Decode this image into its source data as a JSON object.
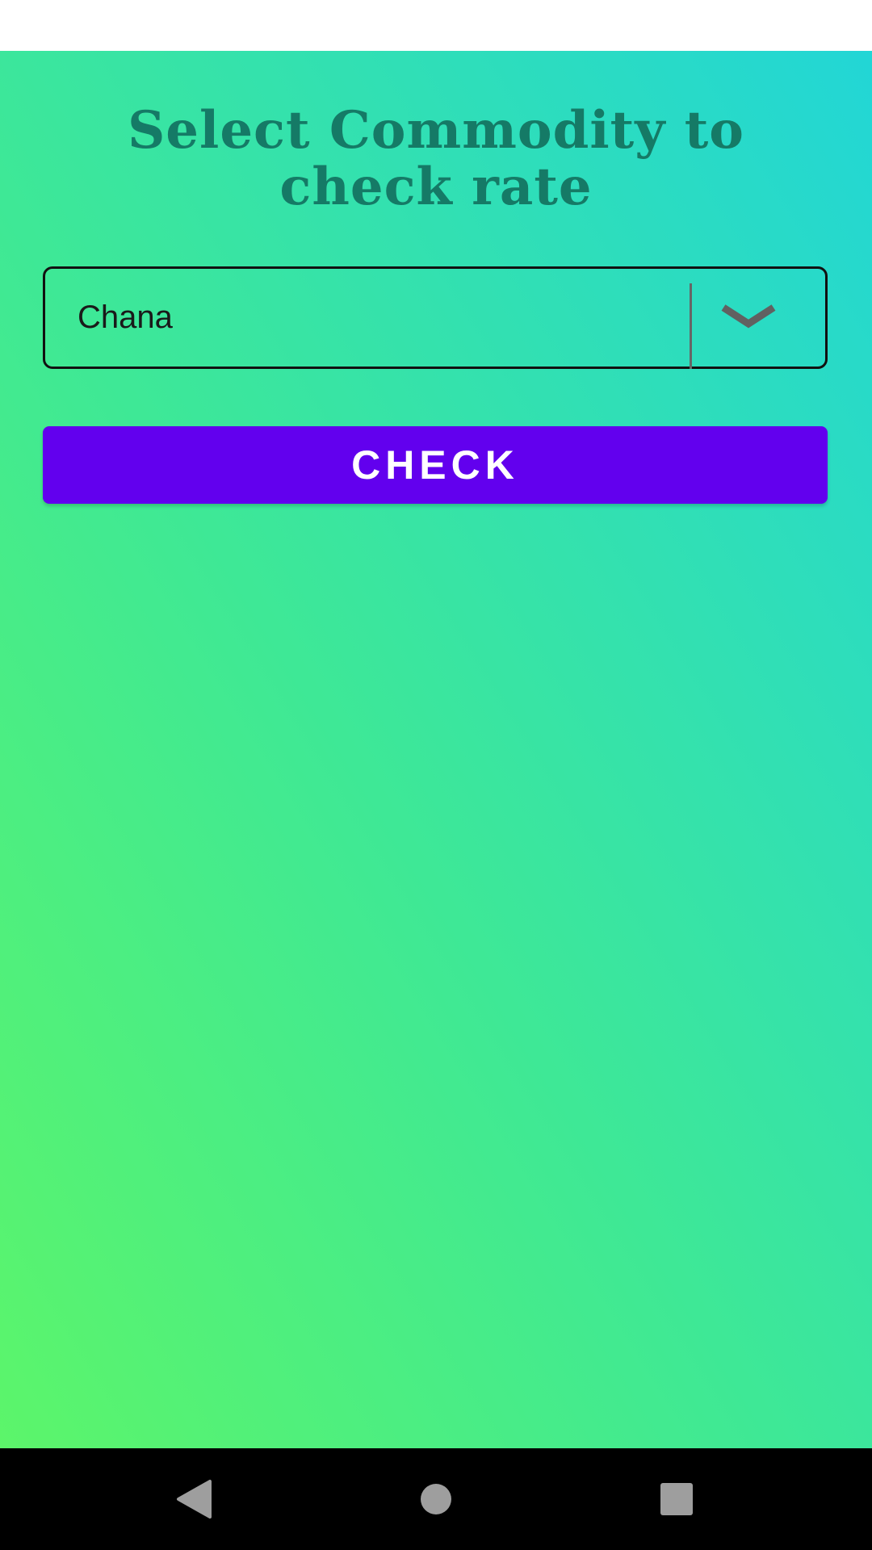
{
  "header": {
    "title": "Select Commodity to check rate"
  },
  "commodity_spinner": {
    "selected_value": "Chana",
    "icon": "chevron-down-icon"
  },
  "check_button": {
    "label": "CHECK"
  },
  "navigation_bar": {
    "back_icon": "triangle-back-icon",
    "home_icon": "circle-home-icon",
    "recents_icon": "square-recents-icon"
  },
  "colors": {
    "title_text": "#157a66",
    "button_background": "#6200ee",
    "button_text": "#ffffff",
    "gradient_top": "#22d6d6",
    "gradient_bottom": "#5cf56a",
    "nav_background": "#000000",
    "nav_icons": "#9e9e9e"
  }
}
